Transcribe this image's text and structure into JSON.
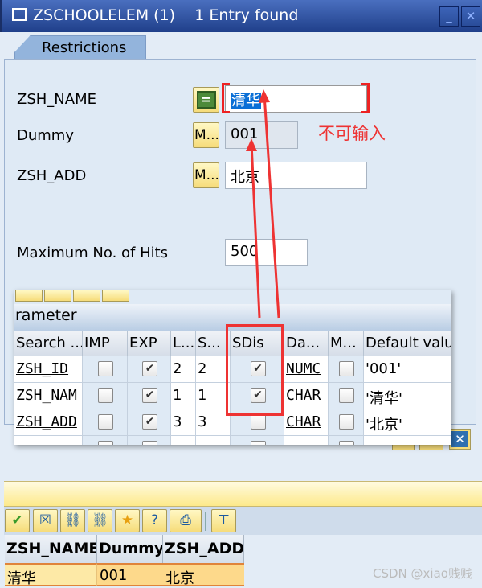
{
  "window": {
    "title": "ZSCHOOLELEM (1)    1 Entry found",
    "minimize_icon": "minimize-icon",
    "close_icon": "close-icon"
  },
  "tabs": [
    {
      "label": "Restrictions",
      "active": true
    }
  ],
  "fields": [
    {
      "label": "ZSH_NAME",
      "option": "=",
      "value": "清华",
      "selected": true
    },
    {
      "label": "Dummy",
      "option": "M...",
      "value": "001",
      "readonly": true
    },
    {
      "label": "ZSH_ADD",
      "option": "M...",
      "value": "北京"
    }
  ],
  "max_hits": {
    "label": "Maximum No. of Hits",
    "value": "500"
  },
  "annotation": {
    "text": "不可输入",
    "color": "#ee3333"
  },
  "param_popup": {
    "title": "rameter",
    "columns": [
      "Search ...",
      "IMP",
      "EXP",
      "L...",
      "S...",
      "SDis",
      "Da...",
      "M...",
      "Default valu"
    ],
    "rows": [
      {
        "name": "ZSH_ID",
        "imp": false,
        "exp": true,
        "l": "2",
        "s": "2",
        "sdis": true,
        "type": "NUMC",
        "m": false,
        "default": "'001'"
      },
      {
        "name": "ZSH_NAM",
        "imp": false,
        "exp": true,
        "l": "1",
        "s": "1",
        "sdis": true,
        "type": "CHAR",
        "m": false,
        "default": "'清华'"
      },
      {
        "name": "ZSH_ADD",
        "imp": false,
        "exp": true,
        "l": "3",
        "s": "3",
        "sdis": false,
        "type": "CHAR",
        "m": false,
        "default": "'北京'"
      }
    ]
  },
  "result_toolbar": [
    "check-icon",
    "cancel-icon",
    "find-icon",
    "find-next-icon",
    "favorite-add-icon",
    "help-icon",
    "print-icon",
    "filter-icon"
  ],
  "result_table": {
    "columns": [
      "ZSH_NAME",
      "Dummy",
      "ZSH_ADD"
    ],
    "rows": [
      [
        "清华",
        "001",
        "北京"
      ]
    ]
  },
  "watermark": "CSDN @xiao贱贱",
  "accent": "#1f3f8a"
}
